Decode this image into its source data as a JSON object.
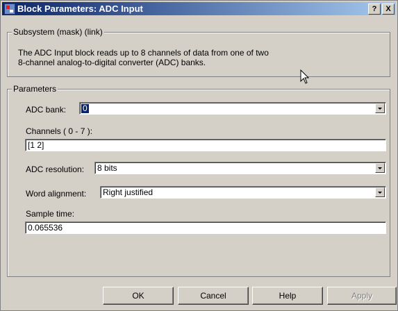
{
  "window": {
    "title": "Block Parameters: ADC Input"
  },
  "titlebar_buttons": {
    "help": "?",
    "close": "X"
  },
  "subsystem": {
    "legend": "Subsystem (mask) (link)",
    "description_line1": "The ADC Input block reads up to 8 channels of data from one of two",
    "description_line2": "8-channel analog-to-digital converter (ADC) banks."
  },
  "parameters": {
    "legend": "Parameters",
    "adc_bank": {
      "label": "ADC bank:",
      "value": "0"
    },
    "channels": {
      "label": "Channels ( 0 - 7 ):",
      "value": "[1 2]"
    },
    "adc_resolution": {
      "label": "ADC resolution:",
      "value": "8 bits"
    },
    "word_alignment": {
      "label": "Word alignment:",
      "value": "Right justified"
    },
    "sample_time": {
      "label": "Sample time:",
      "value": "0.065536"
    }
  },
  "buttons": {
    "ok": "OK",
    "cancel": "Cancel",
    "help": "Help",
    "apply": "Apply"
  },
  "icons": {
    "app": "simulink-block-icon",
    "cursor": "mouse-cursor-icon"
  }
}
